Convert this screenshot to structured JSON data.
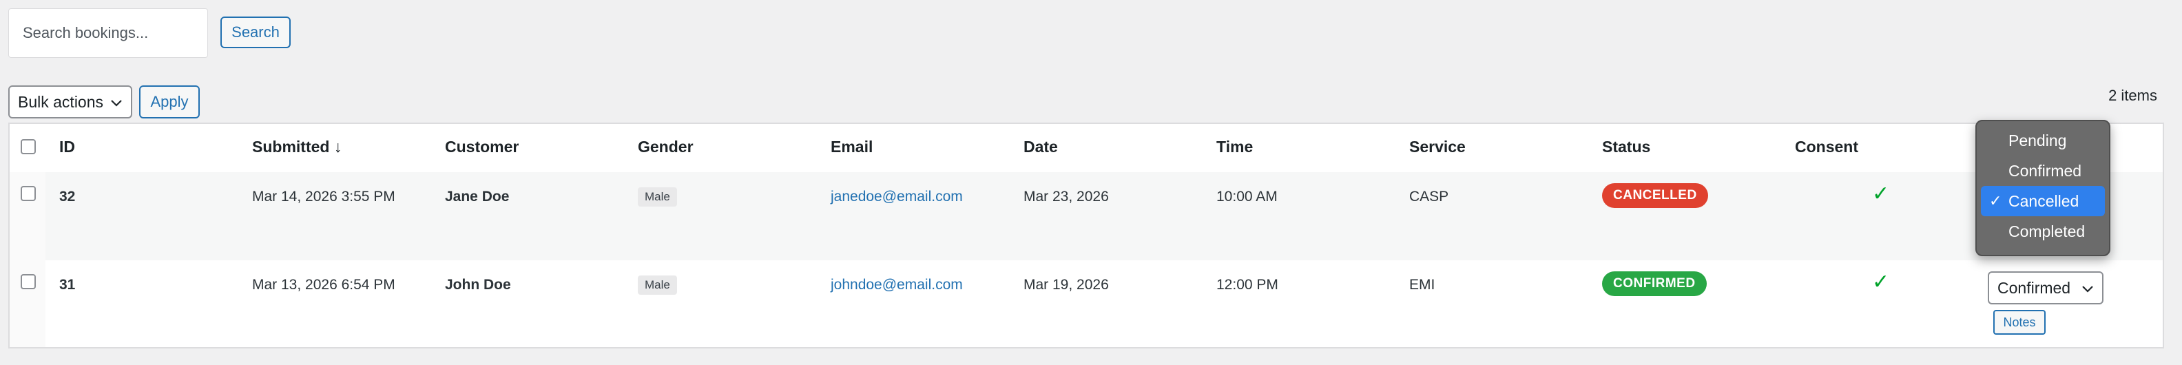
{
  "search": {
    "placeholder": "Search bookings...",
    "button_label": "Search"
  },
  "bulk": {
    "selected": "Bulk actions",
    "apply_label": "Apply"
  },
  "items_count": "2 items",
  "table": {
    "headers": {
      "id": "ID",
      "submitted": "Submitted ↓",
      "customer": "Customer",
      "gender": "Gender",
      "email": "Email",
      "date": "Date",
      "time": "Time",
      "service": "Service",
      "status": "Status",
      "consent": "Consent"
    },
    "rows": [
      {
        "id": "32",
        "submitted": "Mar 14, 2026 3:55 PM",
        "customer": "Jane Doe",
        "gender": "Male",
        "email": "janedoe@email.com",
        "date": "Mar 23, 2026",
        "time": "10:00 AM",
        "service": "CASP",
        "status": "CANCELLED",
        "status_color": "#e0412f",
        "consent": "✓"
      },
      {
        "id": "31",
        "submitted": "Mar 13, 2026 6:54 PM",
        "customer": "John Doe",
        "gender": "Male",
        "email": "johndoe@email.com",
        "date": "Mar 19, 2026",
        "time": "12:00 PM",
        "service": "EMI",
        "status": "CONFIRMED",
        "status_color": "#28a745",
        "consent": "✓",
        "status_select": "Confirmed",
        "notes_label": "Notes"
      }
    ]
  },
  "status_dropdown": {
    "options": [
      "Pending",
      "Confirmed",
      "Cancelled",
      "Completed"
    ],
    "selected": "Cancelled",
    "check_icon": "checkmark-icon"
  },
  "colors": {
    "accent": "#2271b1",
    "cancelled": "#e0412f",
    "confirmed": "#28a745",
    "consent_check": "#00a32a",
    "dropdown_highlight": "#2f80ed"
  }
}
